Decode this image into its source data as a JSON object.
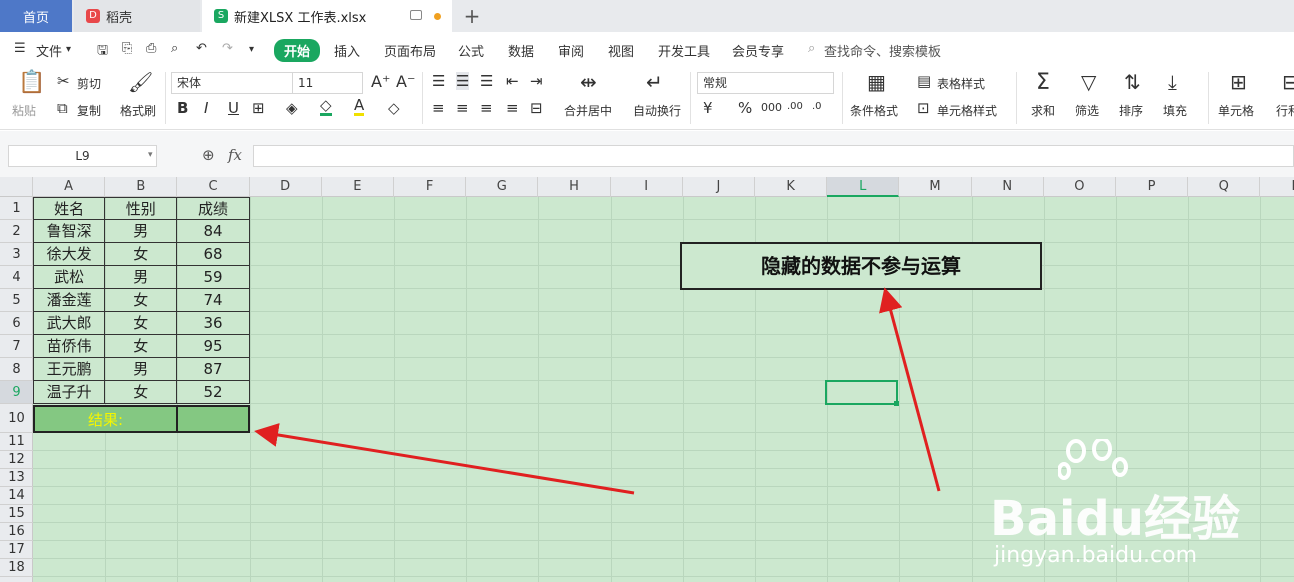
{
  "tabs": {
    "home": "首页",
    "daoke": "稻壳",
    "file": "新建XLSX 工作表.xlsx",
    "add": "+"
  },
  "menubar": {
    "file": "文件",
    "items": [
      "开始",
      "插入",
      "页面布局",
      "公式",
      "数据",
      "审阅",
      "视图",
      "开发工具",
      "会员专享"
    ],
    "search": "查找命令、搜索模板"
  },
  "ribbon": {
    "paste": "粘贴",
    "cut": "剪切",
    "copy": "复制",
    "format_painter": "格式刷",
    "font_name": "宋体",
    "font_size": "11",
    "number_format": "常规",
    "merge_center": "合并居中",
    "wrap_text": "自动换行",
    "table_style": "表格样式",
    "conditional_format": "条件格式",
    "cell_style": "单元格样式",
    "sum": "求和",
    "filter": "筛选",
    "sort": "排序",
    "fill": "填充",
    "cell": "单元格",
    "rows_cols": "行和"
  },
  "formula_bar": {
    "name_box": "L9",
    "fx": "fx",
    "value": ""
  },
  "columns": [
    "A",
    "B",
    "C",
    "D",
    "E",
    "F",
    "G",
    "H",
    "I",
    "J",
    "K",
    "L",
    "M",
    "N",
    "O",
    "P",
    "Q",
    "R"
  ],
  "rows": [
    "1",
    "2",
    "3",
    "4",
    "5",
    "6",
    "7",
    "8",
    "9",
    "10",
    "11",
    "12",
    "13",
    "14",
    "15",
    "16",
    "17",
    "18"
  ],
  "table": {
    "headers": [
      "姓名",
      "性别",
      "成绩"
    ],
    "rows": [
      [
        "鲁智深",
        "男",
        "84"
      ],
      [
        "徐大发",
        "女",
        "68"
      ],
      [
        "武松",
        "男",
        "59"
      ],
      [
        "潘金莲",
        "女",
        "74"
      ],
      [
        "武大郎",
        "女",
        "36"
      ],
      [
        "苗侨伟",
        "女",
        "95"
      ],
      [
        "王元鹏",
        "男",
        "87"
      ],
      [
        "温子升",
        "女",
        "52"
      ]
    ],
    "result_label": "结果:",
    "result_value": ""
  },
  "callout": "隐藏的数据不参与运算",
  "watermark": {
    "brand": "Baidu经验",
    "url": "jingyan.baidu.com"
  },
  "colors": {
    "sheet_bg": "#cce8cf",
    "accent": "#1aa760",
    "result_fill": "#84c882",
    "result_text": "#f5f500",
    "arrow": "#e02020"
  }
}
